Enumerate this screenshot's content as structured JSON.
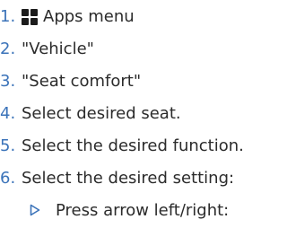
{
  "colors": {
    "number": "#3b73b9",
    "text": "#2b2b2b",
    "bullet": "#3b73b9"
  },
  "steps": [
    {
      "num": "1.",
      "text": "Apps menu",
      "icon": "apps-grid-icon"
    },
    {
      "num": "2.",
      "text": "\"Vehicle\""
    },
    {
      "num": "3.",
      "text": "\"Seat comfort\""
    },
    {
      "num": "4.",
      "text": "Select desired seat."
    },
    {
      "num": "5.",
      "text": "Select the desired function."
    },
    {
      "num": "6.",
      "text": "Select the desired setting:"
    }
  ],
  "substeps": [
    {
      "text": "Press arrow left/right:",
      "icon": "triangle-right-icon"
    }
  ]
}
